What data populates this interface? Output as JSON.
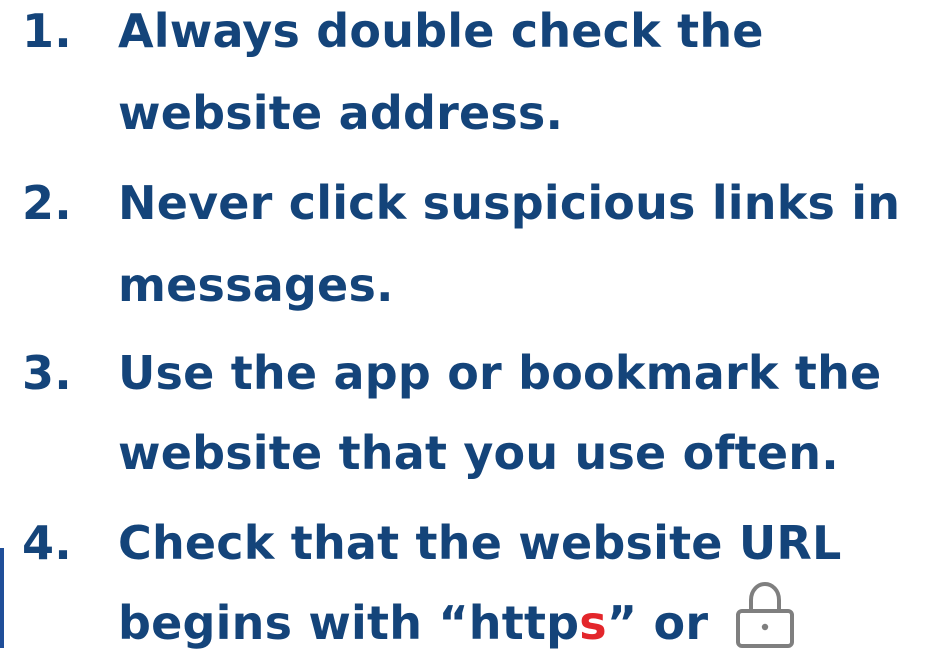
{
  "tips": [
    {
      "number": "1.",
      "line1": "Always double check the",
      "line2": "website address."
    },
    {
      "number": "2.",
      "line1": "Never click suspicious links in",
      "line2": "messages."
    },
    {
      "number": "3.",
      "line1": "Use the app or bookmark the",
      "line2": "website that you use often."
    },
    {
      "number": "4.",
      "line1": "Check that the website URL",
      "line2_prefix": "begins with “http",
      "line2_red": "s",
      "line2_suffix": "” or"
    }
  ],
  "icons": {
    "lock": "lock-icon"
  },
  "colors": {
    "text": "#14447a",
    "highlight": "#e3262b",
    "accent": "#1f4e99",
    "icon": "#7f7f7f"
  }
}
